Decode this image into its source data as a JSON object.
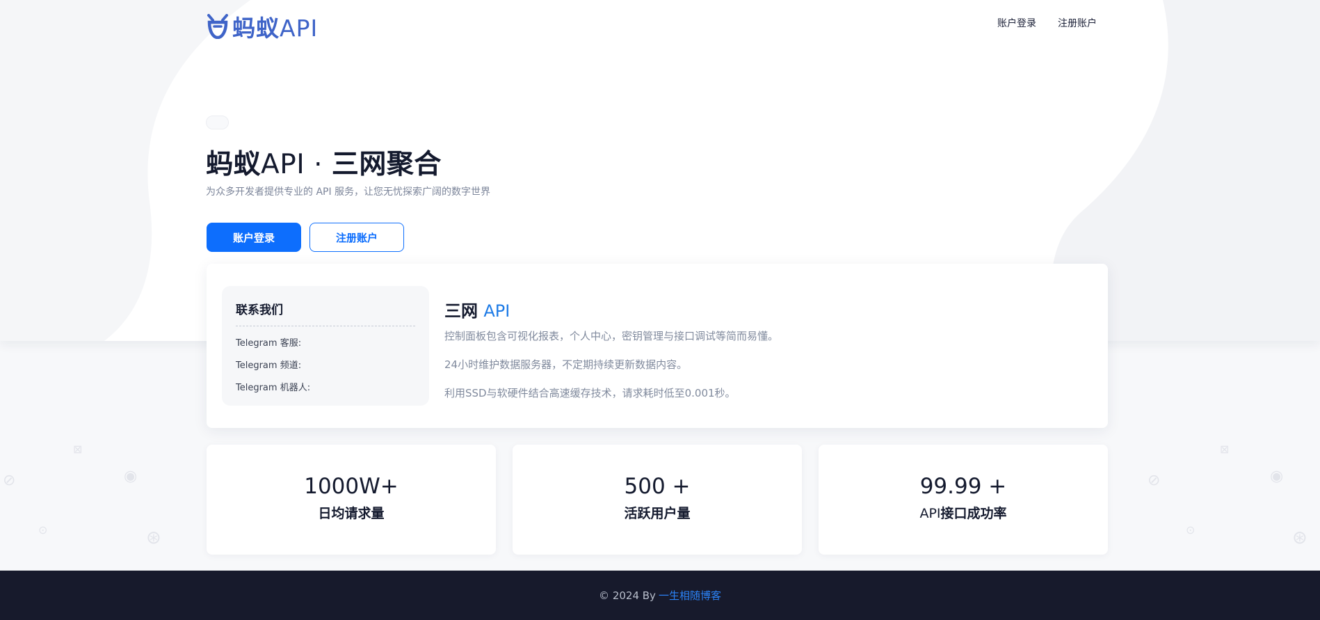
{
  "brand": {
    "logo_cn": "蚂蚁",
    "logo_api": "API",
    "accent": "#3f64c8"
  },
  "nav": {
    "login": "账户登录",
    "register": "注册账户"
  },
  "hero": {
    "title_cn": "蚂蚁",
    "title_api": "API · ",
    "title_rest": "三网聚合",
    "subtitle": "为众多开发者提供专业的 API 服务，让您无忧探索广阔的数字世界",
    "login_button": "账户登录",
    "register_button": "注册账户"
  },
  "contact": {
    "title": "联系我们",
    "items": [
      "Telegram 客服:",
      "Telegram 频道:",
      "Telegram 机器人:"
    ]
  },
  "feature": {
    "title_cn": "三网",
    "title_api": "API",
    "lines": [
      "控制面板包含可视化报表，个人中心，密钥管理与接口调试等简而易懂。",
      "24小时维护数据服务器，不定期持续更新数据内容。",
      "利用SSD与软硬件结合高速缓存技术，请求耗时低至0.001秒。"
    ]
  },
  "stats": [
    {
      "value": "1000W+",
      "label": "日均请求量",
      "label_prefix": ""
    },
    {
      "value": "500 +",
      "label": "活跃用户量",
      "label_prefix": ""
    },
    {
      "value": "99.99 +",
      "label": "接口成功率",
      "label_prefix": "API"
    }
  ],
  "footer": {
    "copyright": "© 2024 By",
    "link": "一生相随博客"
  },
  "colors": {
    "primary": "#0d6efd",
    "footer_bg": "#171a2c",
    "link": "#2b83f6"
  }
}
